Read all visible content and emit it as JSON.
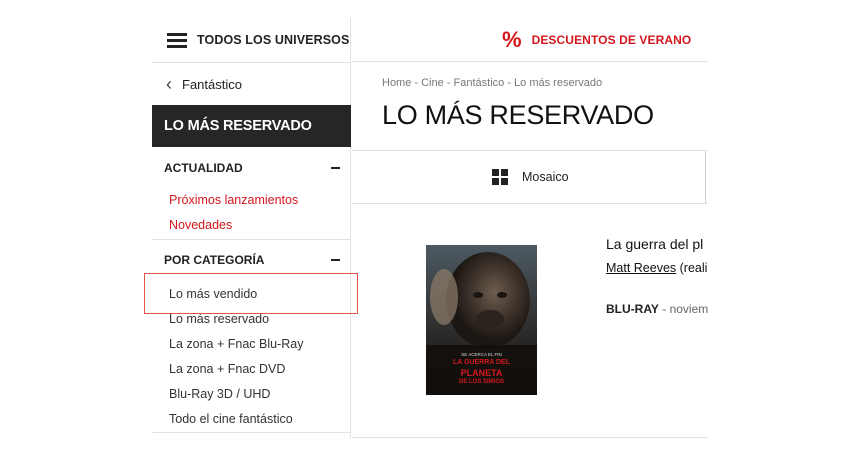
{
  "sidebar": {
    "universes_label": "TODOS LOS UNIVERSOS",
    "back_label": "Fantástico",
    "section_title": "LO MÁS RESERVADO",
    "groups": [
      {
        "title": "ACTUALIDAD",
        "items": [
          "Próximos lanzamientos",
          "Novedades"
        ]
      },
      {
        "title": "POR CATEGORÍA",
        "items": [
          "Lo más vendido",
          "Lo más reservado",
          "La zona + Fnac Blu-Ray",
          "La zona + Fnac DVD",
          "Blu-Ray 3D / UHD",
          "Todo el cine fantástico"
        ]
      }
    ]
  },
  "topbar": {
    "promo_icon": "%",
    "promo_label": "DESCUENTOS DE VERANO"
  },
  "main": {
    "breadcrumb": "Home - Cine - Fantástico - Lo más reservado",
    "page_title": "LO MÁS RESERVADO",
    "view_label": "Mosaico"
  },
  "product": {
    "poster_tagline": "SE ACERCA EL FIN",
    "poster_title_1": "LA GUERRA DEL",
    "poster_title_2": "PLANETA",
    "poster_title_3": "DE LOS SIMIOS",
    "title": "La guerra del pl",
    "author": "Matt Reeves",
    "author_suffix": " (reali",
    "format": "BLU-RAY",
    "date": " - noviemb"
  },
  "colors": {
    "accent": "#d4171c",
    "highlight": "#e0554a",
    "dark": "#262626"
  }
}
